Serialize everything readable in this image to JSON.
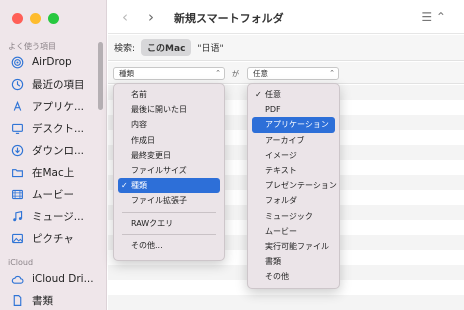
{
  "sidebar": {
    "favorites_header": "よく使う項目",
    "favorites": [
      {
        "label": "AirDrop",
        "icon": "airdrop-icon"
      },
      {
        "label": "最近の項目",
        "icon": "clock-icon"
      },
      {
        "label": "アプリケ...",
        "icon": "applications-icon"
      },
      {
        "label": "デスクト...",
        "icon": "desktop-icon"
      },
      {
        "label": "ダウンロ...",
        "icon": "download-icon"
      },
      {
        "label": "在Mac上",
        "icon": "folder-icon"
      },
      {
        "label": "ムービー",
        "icon": "movie-icon"
      },
      {
        "label": "ミュージ...",
        "icon": "music-icon"
      },
      {
        "label": "ピクチャ",
        "icon": "pictures-icon"
      }
    ],
    "icloud_header": "iCloud",
    "icloud": [
      {
        "label": "iCloud Dri...",
        "icon": "cloud-icon"
      },
      {
        "label": "書類",
        "icon": "document-icon"
      }
    ]
  },
  "toolbar": {
    "back": "‹",
    "forward": "›",
    "title": "新規スマートフォルダ",
    "view_icon": "☰ ⌃"
  },
  "search": {
    "label": "検索:",
    "scope_selected": "このMac",
    "scope_other": "\"日语\""
  },
  "criteria": {
    "attribute": "種類",
    "connector": "が",
    "value": "任意"
  },
  "attribute_menu": {
    "items": [
      {
        "label": "名前"
      },
      {
        "label": "最後に開いた日"
      },
      {
        "label": "内容"
      },
      {
        "label": "作成日"
      },
      {
        "label": "最終変更日"
      },
      {
        "label": "ファイルサイズ"
      },
      {
        "label": "種類",
        "checked": true,
        "selected": true
      },
      {
        "label": "ファイル拡張子"
      }
    ],
    "raw_query": "RAWクエリ",
    "other": "その他..."
  },
  "kind_menu": {
    "items": [
      {
        "label": "任意",
        "checked": true
      },
      {
        "label": "PDF"
      },
      {
        "label": "アプリケーション",
        "selected": true
      },
      {
        "label": "アーカイブ"
      },
      {
        "label": "イメージ"
      },
      {
        "label": "テキスト"
      },
      {
        "label": "プレゼンテーション"
      },
      {
        "label": "フォルダ"
      },
      {
        "label": "ミュージック"
      },
      {
        "label": "ムービー"
      },
      {
        "label": "実行可能ファイル"
      },
      {
        "label": "書類"
      },
      {
        "label": "その他"
      }
    ]
  },
  "colors": {
    "accent": "#2d6fd8",
    "sidebar_bg": "#efe6ea",
    "icon_blue": "#2f74d6"
  }
}
